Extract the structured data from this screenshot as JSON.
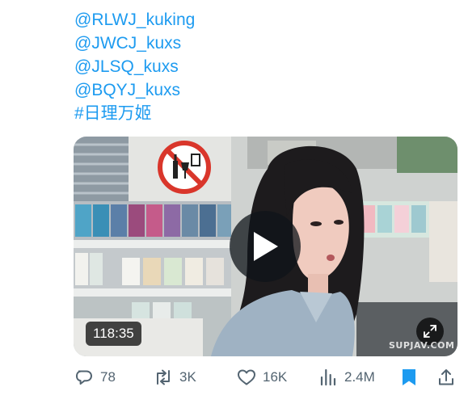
{
  "mentions": [
    "@RLWJ_kuking",
    "@JWCJ_kuxs",
    "@JLSQ_kuxs",
    "@BQYJ_kuxs"
  ],
  "hashtag": "#日理万姬",
  "video": {
    "duration": "118:35",
    "watermark": "SUPJAV.COM",
    "play_icon": "play-icon",
    "expand_icon": "expand-icon"
  },
  "actions": {
    "replies": "78",
    "reposts": "3K",
    "likes": "16K",
    "views": "2.4M",
    "bookmarked": true
  },
  "colors": {
    "link": "#1d9bf0",
    "icon_gray": "#536471",
    "bookmark_active": "#1d9bf0"
  }
}
